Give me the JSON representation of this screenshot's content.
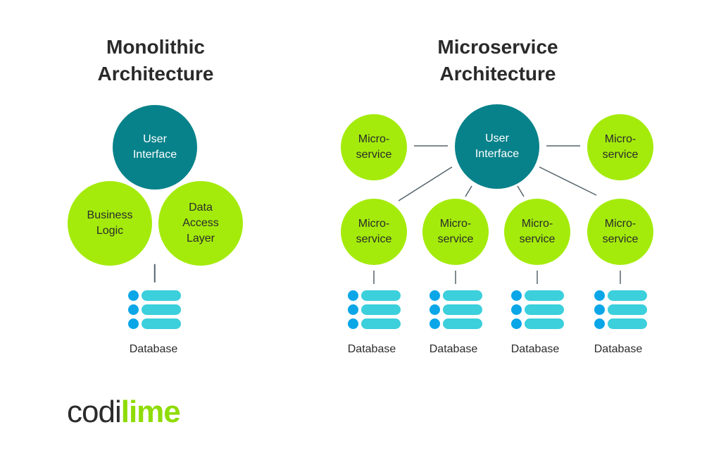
{
  "monolithic": {
    "title_line1": "Monolithic",
    "title_line2": "Architecture",
    "user_interface": "User Interface",
    "business_logic": "Business Logic",
    "data_access_layer": "Data Access Layer",
    "database_label": "Database"
  },
  "microservice": {
    "title_line1": "Microservice",
    "title_line2": "Architecture",
    "user_interface": "User Interface",
    "service_label": "Micro- service",
    "database_label": "Database",
    "service_count": 6,
    "database_count": 4
  },
  "logo": {
    "part1": "codi",
    "part2": "lime"
  },
  "colors": {
    "ui": "#08828a",
    "service": "#a4eb0c",
    "db_dot": "#0aa6e8",
    "db_bar": "#3ccfdc",
    "logo_green": "#8fdc06"
  }
}
